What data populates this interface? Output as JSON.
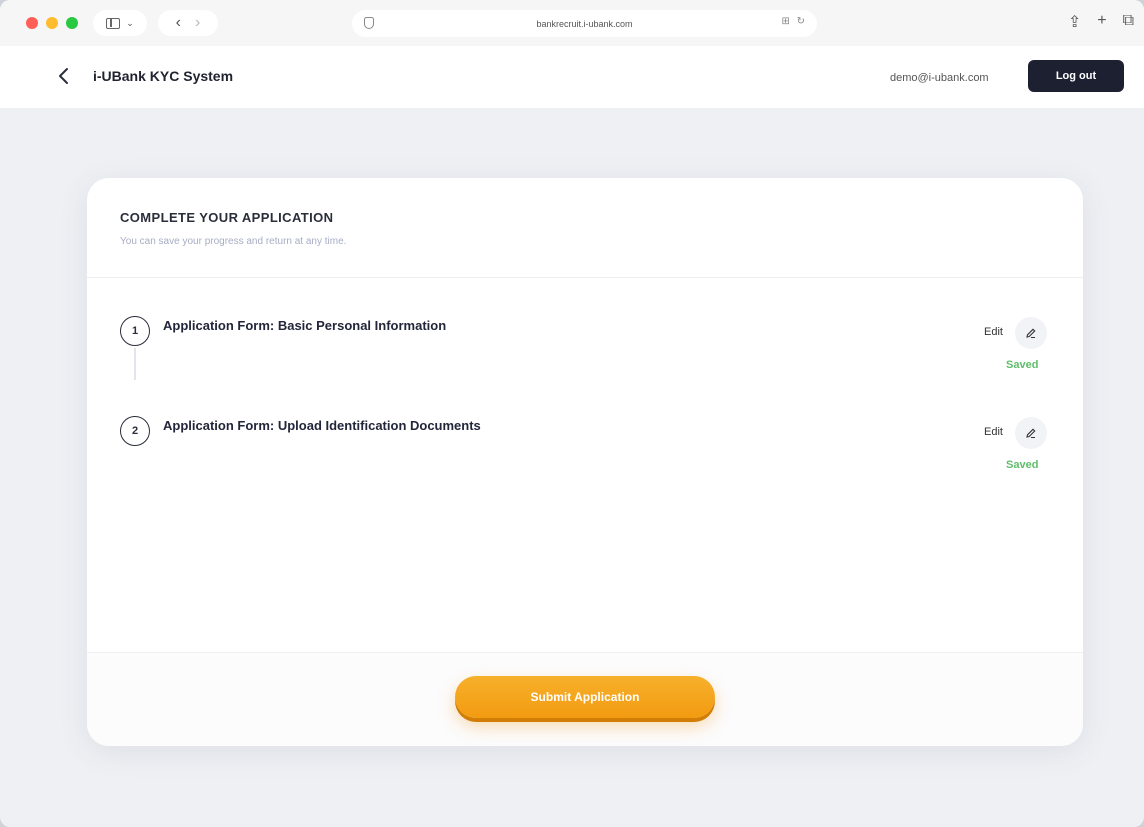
{
  "browser": {
    "url": "bankrecruit.i-ubank.com",
    "reader_glyph": "⊞ ↻"
  },
  "header": {
    "title": "i-UBank KYC System",
    "user_email": "demo@i-ubank.com",
    "logout_label": "Log out"
  },
  "card": {
    "title": "COMPLETE YOUR APPLICATION",
    "subtitle": "You can save your progress and return at any time.",
    "steps": [
      {
        "number": "1",
        "label": "Application Form: Basic Personal Information",
        "edit_label": "Edit",
        "status": "Saved"
      },
      {
        "number": "2",
        "label": "Application Form: Upload Identification Documents",
        "edit_label": "Edit",
        "status": "Saved"
      }
    ],
    "submit_label": "Submit Application"
  },
  "colors": {
    "accent": "#f29b11",
    "saved": "#5fbd6b",
    "dark": "#1c2030"
  }
}
